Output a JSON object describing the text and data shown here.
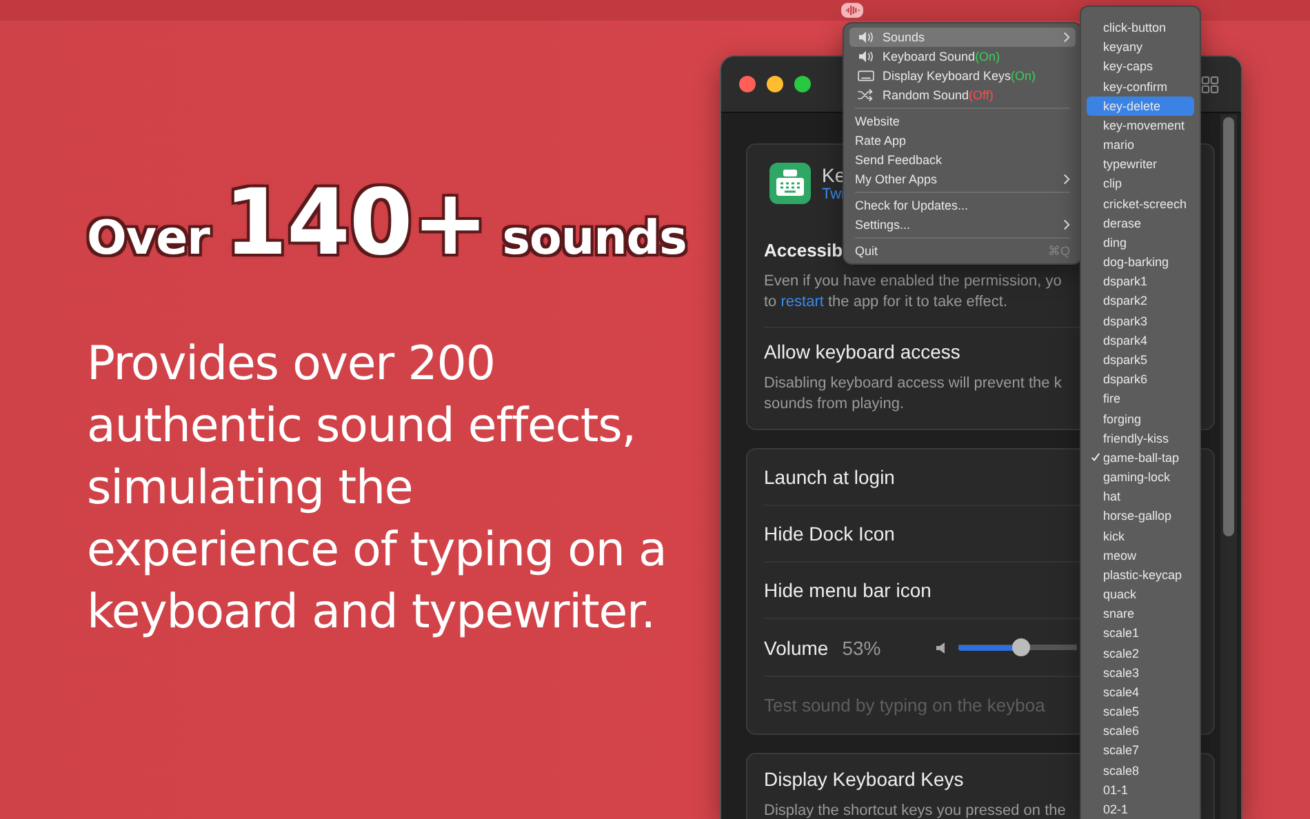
{
  "headline": {
    "lead": "Over",
    "number": "140+",
    "tail": "sounds"
  },
  "description": "Provides over 200\nauthentic sound effects,\nsimulating the\nexperience of typing on a\nkeyboard and typewriter.",
  "window": {
    "app": {
      "name": "Ke",
      "link": "Twi"
    },
    "cards": [
      {
        "rows": [
          {
            "kind": "app"
          },
          {
            "kind": "setting",
            "title": "Accessib",
            "description": [
              {
                "text": "Even if you have enabled the permission, yo\nto "
              },
              {
                "text": "restart",
                "link": true
              },
              {
                "text": " the app for it to take effect."
              }
            ]
          },
          {
            "kind": "setting",
            "title": "Allow keyboard access",
            "description": [
              {
                "text": "Disabling keyboard access will prevent the k\nsounds from playing."
              }
            ]
          }
        ]
      },
      {
        "rows": [
          {
            "kind": "setting",
            "title": "Launch at login"
          },
          {
            "kind": "setting",
            "title": "Hide Dock Icon"
          },
          {
            "kind": "setting",
            "title": "Hide menu bar icon"
          },
          {
            "kind": "slider",
            "title": "Volume",
            "reading": "53%",
            "level": 0.53
          },
          {
            "kind": "field",
            "placeholder": "Test sound by typing on the keyboa"
          }
        ]
      },
      {
        "rows": [
          {
            "kind": "setting",
            "title": "Display Keyboard Keys",
            "description": [
              {
                "text": "Display the shortcut keys you pressed on the"
              }
            ]
          }
        ]
      }
    ]
  },
  "menu": {
    "groups": [
      [
        {
          "label": "Sounds",
          "submenu": true,
          "highlighted": true
        },
        {
          "label": "Keyboard Sound",
          "status": "(On)",
          "on": true,
          "highlighted": false
        },
        {
          "label": "Display Keyboard Keys",
          "status": "(On)",
          "on": true,
          "highlighted": false
        },
        {
          "label": "Random Sound",
          "status": "(Off)",
          "on": false,
          "highlighted": false
        }
      ],
      [
        {
          "label": "Website",
          "highlighted": false
        },
        {
          "label": "Rate App",
          "highlighted": false
        },
        {
          "label": "Send Feedback",
          "highlighted": false
        },
        {
          "label": "My Other Apps",
          "submenu": true,
          "highlighted": false
        }
      ],
      [
        {
          "label": "Check for Updates...",
          "highlighted": false
        },
        {
          "label": "Settings...",
          "submenu": true,
          "highlighted": false
        }
      ],
      [
        {
          "label": "Quit",
          "shortcut": "⌘Q",
          "highlighted": false
        }
      ]
    ]
  },
  "sounds": [
    {
      "label": "click-button",
      "highlighted": false,
      "checked": false
    },
    {
      "label": "keyany",
      "highlighted": false,
      "checked": false
    },
    {
      "label": "key-caps",
      "highlighted": false,
      "checked": false
    },
    {
      "label": "key-confirm",
      "highlighted": false,
      "checked": false
    },
    {
      "label": "key-delete",
      "highlighted": true,
      "checked": false
    },
    {
      "label": "key-movement",
      "highlighted": false,
      "checked": false
    },
    {
      "label": "mario",
      "highlighted": false,
      "checked": false
    },
    {
      "label": "typewriter",
      "highlighted": false,
      "checked": false
    },
    {
      "label": "clip",
      "highlighted": false,
      "checked": false
    },
    {
      "label": "cricket-screech",
      "highlighted": false,
      "checked": false
    },
    {
      "label": "derase",
      "highlighted": false,
      "checked": false
    },
    {
      "label": "ding",
      "highlighted": false,
      "checked": false
    },
    {
      "label": "dog-barking",
      "highlighted": false,
      "checked": false
    },
    {
      "label": "dspark1",
      "highlighted": false,
      "checked": false
    },
    {
      "label": "dspark2",
      "highlighted": false,
      "checked": false
    },
    {
      "label": "dspark3",
      "highlighted": false,
      "checked": false
    },
    {
      "label": "dspark4",
      "highlighted": false,
      "checked": false
    },
    {
      "label": "dspark5",
      "highlighted": false,
      "checked": false
    },
    {
      "label": "dspark6",
      "highlighted": false,
      "checked": false
    },
    {
      "label": "fire",
      "highlighted": false,
      "checked": false
    },
    {
      "label": "forging",
      "highlighted": false,
      "checked": false
    },
    {
      "label": "friendly-kiss",
      "highlighted": false,
      "checked": false
    },
    {
      "label": "game-ball-tap",
      "highlighted": false,
      "checked": true
    },
    {
      "label": "gaming-lock",
      "highlighted": false,
      "checked": false
    },
    {
      "label": "hat",
      "highlighted": false,
      "checked": false
    },
    {
      "label": "horse-gallop",
      "highlighted": false,
      "checked": false
    },
    {
      "label": "kick",
      "highlighted": false,
      "checked": false
    },
    {
      "label": "meow",
      "highlighted": false,
      "checked": false
    },
    {
      "label": "plastic-keycap",
      "highlighted": false,
      "checked": false
    },
    {
      "label": "quack",
      "highlighted": false,
      "checked": false
    },
    {
      "label": "snare",
      "highlighted": false,
      "checked": false
    },
    {
      "label": "scale1",
      "highlighted": false,
      "checked": false
    },
    {
      "label": "scale2",
      "highlighted": false,
      "checked": false
    },
    {
      "label": "scale3",
      "highlighted": false,
      "checked": false
    },
    {
      "label": "scale4",
      "highlighted": false,
      "checked": false
    },
    {
      "label": "scale5",
      "highlighted": false,
      "checked": false
    },
    {
      "label": "scale6",
      "highlighted": false,
      "checked": false
    },
    {
      "label": "scale7",
      "highlighted": false,
      "checked": false
    },
    {
      "label": "scale8",
      "highlighted": false,
      "checked": false
    },
    {
      "label": "01-1",
      "highlighted": false,
      "checked": false
    },
    {
      "label": "02-1",
      "highlighted": false,
      "checked": false
    }
  ]
}
